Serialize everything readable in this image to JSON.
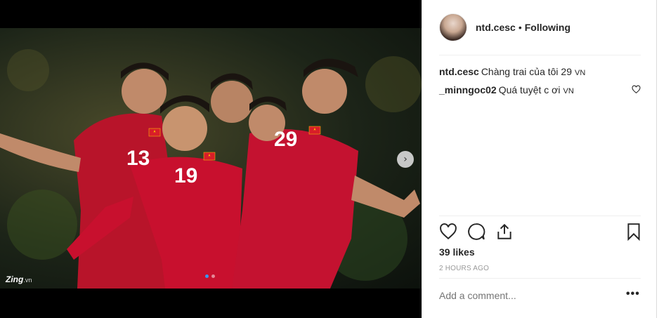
{
  "post": {
    "username": "ntd.cesc",
    "separator": "•",
    "follow_status": "Following",
    "likes": "39 likes",
    "time": "2 HOURS AGO",
    "comment_placeholder": "Add a comment...",
    "more_label": "•••",
    "carousel_next": "›",
    "watermark": "Zing",
    "watermark_tld": ".vn"
  },
  "comments": [
    {
      "user": "ntd.cesc",
      "text": "Chàng trai của tôi 29",
      "flag": "VN"
    },
    {
      "user": "_minngoc02",
      "text": "Quá tuyệt c ơi",
      "flag": "VN"
    }
  ],
  "photo": {
    "description_numbers": [
      "13",
      "19",
      "29"
    ],
    "jersey_color": "#c8102e",
    "star_color": "#ffd100"
  },
  "colors": {
    "accent": "#3897f0",
    "text": "#262626",
    "muted": "#999999"
  },
  "icons": [
    "heart-icon",
    "comment-icon",
    "share-icon",
    "bookmark-icon",
    "heart-small-icon",
    "chevron-right-icon"
  ]
}
